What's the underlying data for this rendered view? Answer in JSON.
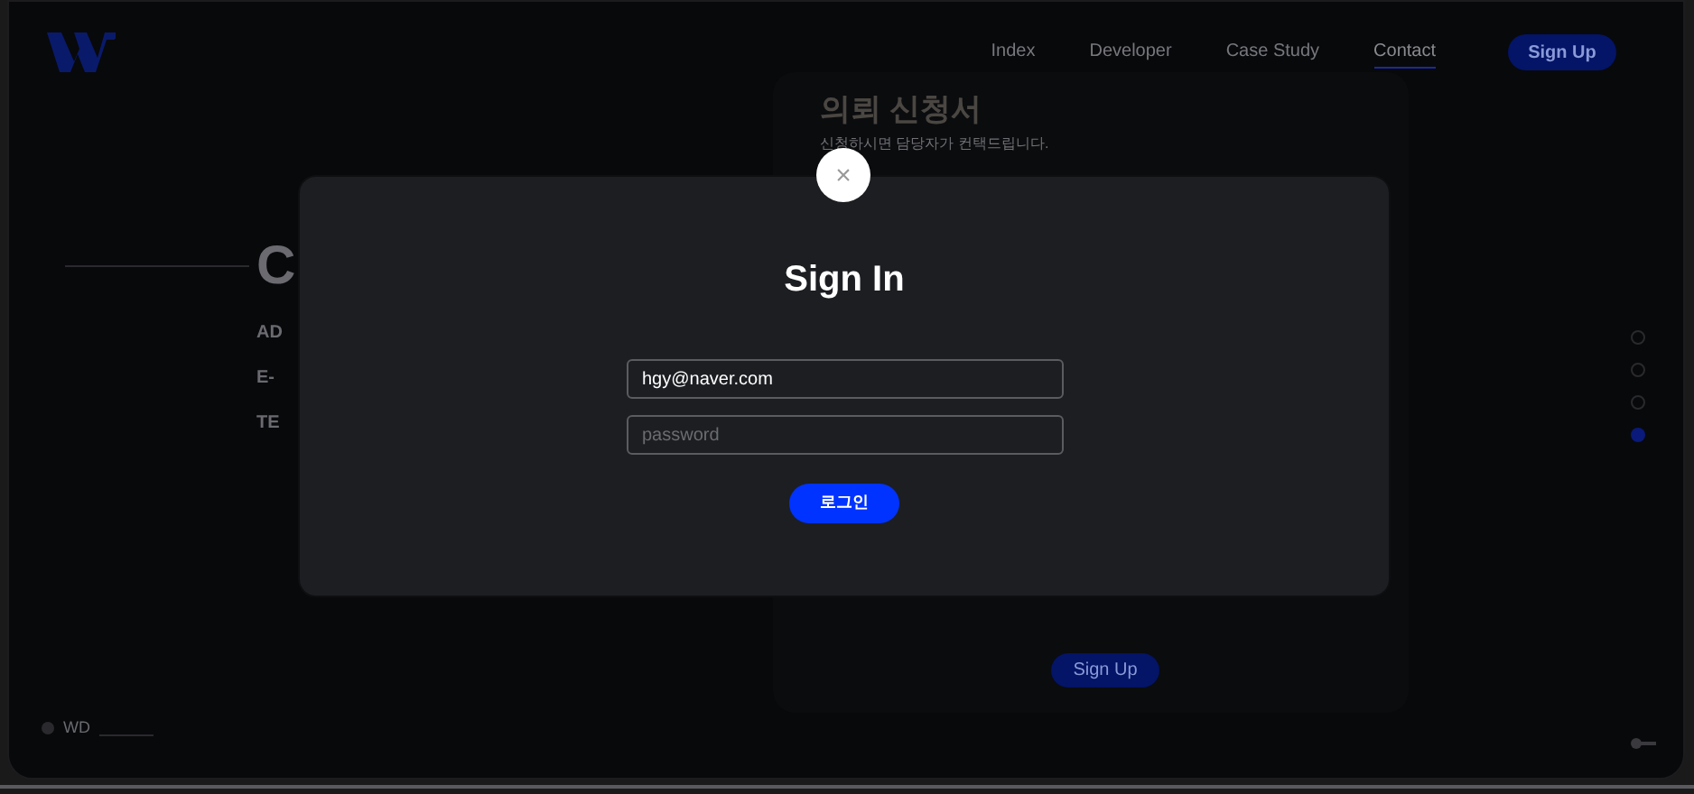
{
  "header": {
    "nav": [
      {
        "label": "Index",
        "selected": false
      },
      {
        "label": "Developer",
        "selected": false
      },
      {
        "label": "Case Study",
        "selected": false
      },
      {
        "label": "Contact",
        "selected": true
      }
    ],
    "signup_button": "Sign Up"
  },
  "contact": {
    "heading": "C",
    "lines": [
      "AD",
      "E-",
      "TE"
    ]
  },
  "request_form": {
    "title": "의뢰 신청서",
    "subtitle": "신청하시면 담당자가 컨택드립니다.",
    "submit": "Sign Up"
  },
  "page_dots": [
    {
      "selected": false
    },
    {
      "selected": false
    },
    {
      "selected": false
    },
    {
      "selected": true
    }
  ],
  "footer": {
    "brand": "WD"
  },
  "modal": {
    "close": "×",
    "title": "Sign In",
    "email": {
      "value": "hgy@naver.com"
    },
    "password": {
      "placeholder": "password"
    },
    "login_button": "로그인"
  }
}
